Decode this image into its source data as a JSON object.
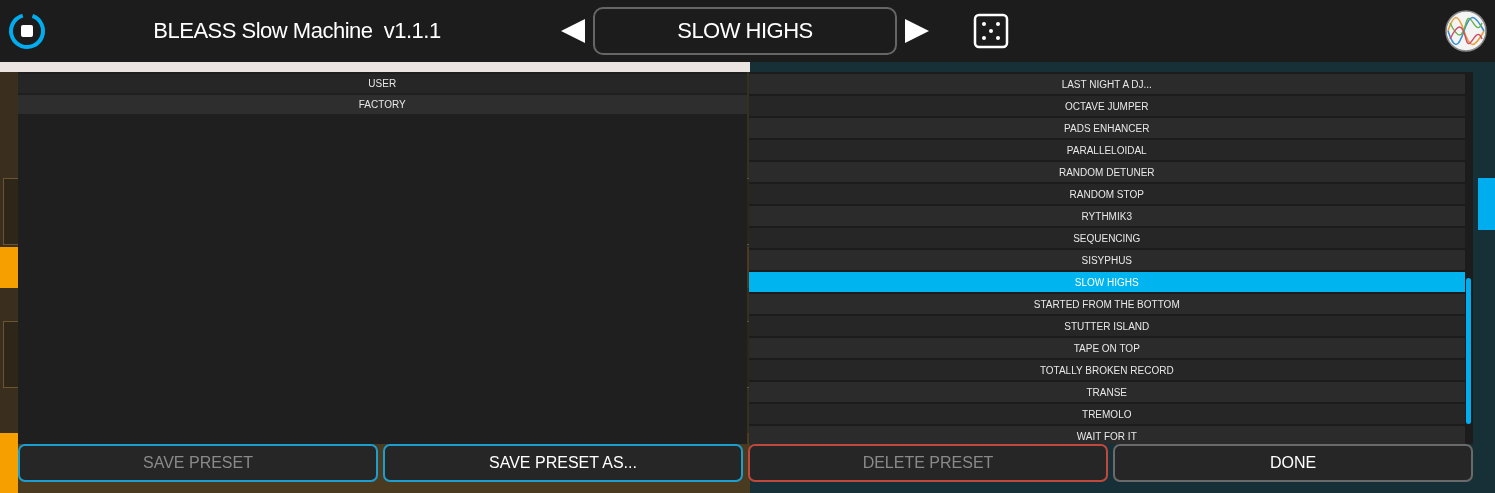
{
  "header": {
    "title": "BLEASS Slow Machine  v1.1.1",
    "preset": "SLOW HIGHS"
  },
  "banks": [
    {
      "label": "USER"
    },
    {
      "label": "FACTORY"
    }
  ],
  "presets": [
    {
      "label": "LAST NIGHT A DJ...",
      "selected": false
    },
    {
      "label": "OCTAVE JUMPER",
      "selected": false
    },
    {
      "label": "PADS ENHANCER",
      "selected": false
    },
    {
      "label": "PARALLELOIDAL",
      "selected": false
    },
    {
      "label": "RANDOM DETUNER",
      "selected": false
    },
    {
      "label": "RANDOM STOP",
      "selected": false
    },
    {
      "label": "RYTHMIK3",
      "selected": false
    },
    {
      "label": "SEQUENCING",
      "selected": false
    },
    {
      "label": "SISYPHUS",
      "selected": false
    },
    {
      "label": "SLOW HIGHS",
      "selected": true
    },
    {
      "label": "STARTED FROM THE BOTTOM",
      "selected": false
    },
    {
      "label": "STUTTER ISLAND",
      "selected": false
    },
    {
      "label": "TAPE ON TOP",
      "selected": false
    },
    {
      "label": "TOTALLY BROKEN RECORD",
      "selected": false
    },
    {
      "label": "TRANSE",
      "selected": false
    },
    {
      "label": "TREMOLO",
      "selected": false
    },
    {
      "label": "WAIT FOR IT",
      "selected": false
    }
  ],
  "buttons": [
    {
      "label": "SAVE PRESET",
      "disabled": true,
      "color": "#1a9fd0"
    },
    {
      "label": "SAVE PRESET AS...",
      "disabled": false,
      "color": "#1a9fd0"
    },
    {
      "label": "DELETE PRESET",
      "disabled": true,
      "color": "#c0483c"
    },
    {
      "label": "DONE",
      "disabled": false,
      "color": "#6a6a6a"
    }
  ]
}
